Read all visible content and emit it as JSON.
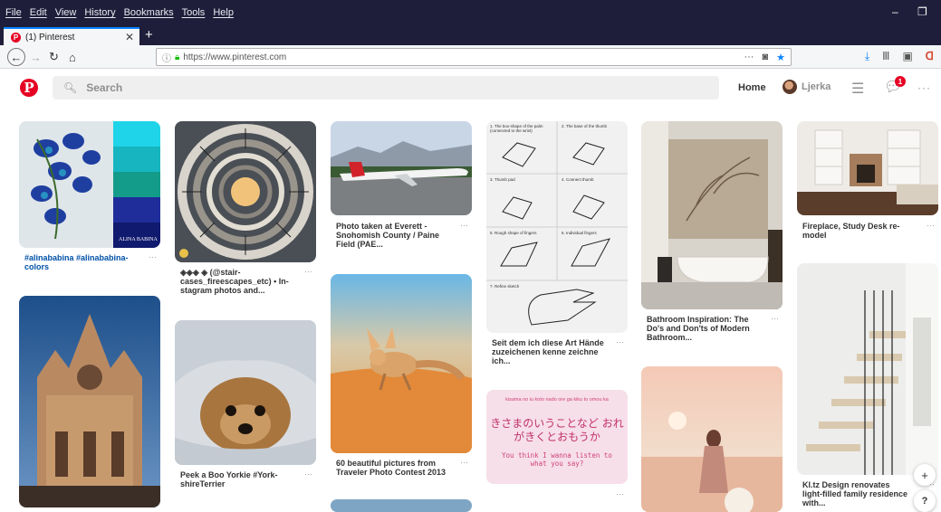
{
  "menubar": {
    "items": [
      "File",
      "Edit",
      "View",
      "History",
      "Bookmarks",
      "Tools",
      "Help"
    ]
  },
  "tab": {
    "title": "(1) Pinterest",
    "close": "✕",
    "new": "+"
  },
  "toolbar": {
    "url": "https://www.pinterest.com",
    "more": "···"
  },
  "pinterest": {
    "logo": "P",
    "search_placeholder": "Search",
    "home": "Home",
    "user": "Ljerka",
    "notifications": "1",
    "more": "···"
  },
  "pins": [
    {
      "caption": "#alinababina #alinababina-colors",
      "watermark": "ALINA BABINA"
    },
    {
      "caption": ""
    },
    {
      "caption": "◈◈◈ ◈ (@stair-cases_fireescapes_etc) • In-stagram photos and..."
    },
    {
      "caption": "Peek a Boo Yorkie #York-shireTerrier"
    },
    {
      "caption": "Photo taken at Everett - Snohomish County / Paine Field (PAE..."
    },
    {
      "caption": "60 beautiful pictures from Traveler Photo Contest 2013"
    },
    {
      "caption": "Seit dem ich diese Art Hände zuzeichenen kenne zeichne ich...",
      "steps": [
        "1. The box-shape of the palm (connected to the wrist)",
        "2. The base of the thumb",
        "3. Thumb pad",
        "4. Connect thumb",
        "5. Rough shape of fingers",
        "6. Individual fingers",
        "7. Refine sketch"
      ]
    },
    {
      "caption": "",
      "romaji": "kisama no iu koto nado ore ga kiku to omou ka",
      "jp": "きさまのいうことなど おれがきくとおもうか",
      "en": "You think I wanna listen to what you say?"
    },
    {
      "caption": "Bathroom Inspiration: The Do's and Don'ts of Modern Bathroom..."
    },
    {
      "caption": ""
    },
    {
      "caption": "Fireplace, Study Desk re-model"
    },
    {
      "caption": "Kl.tz Design renovates light-filled family residence with..."
    }
  ],
  "fab": {
    "plus": "+",
    "help": "?"
  },
  "colors": {
    "pinterest_red": "#e60023",
    "firefox_dark": "#1f1e3a",
    "link_blue": "#0051a8"
  }
}
